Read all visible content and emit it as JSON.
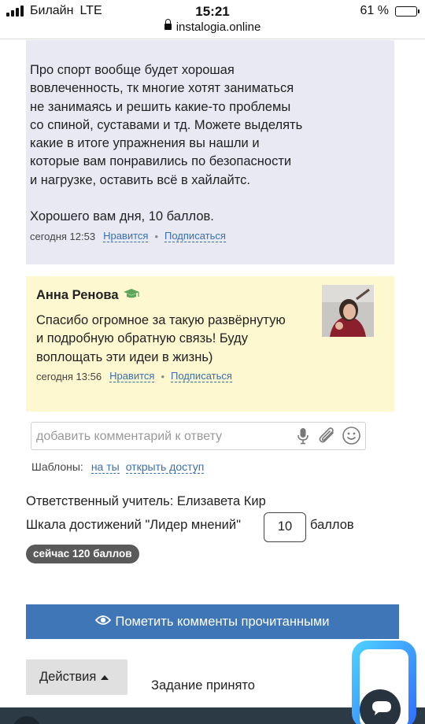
{
  "status_bar": {
    "carrier": "Билайн",
    "network": "LTE",
    "time": "15:21",
    "url": "instalogia.online",
    "battery_percent": "61 %",
    "battery_level": 0.61
  },
  "answer": {
    "text": "Про спорт вообще будет хорошая\nвовлеченность, тк многие хотят заниматься\nне занимаясь и решить какие-то проблемы\nсо спиной, суставами и тд. Можете выделять\nкакие в итоге упражнения вы нашли и\nкоторые вам понравились по безопасности\nи нагрузке, оставить всё в хайлайтс.\n\nХорошего вам дня, 10 баллов.",
    "time": "сегодня 12:53",
    "like": "Нравится",
    "subscribe": "Подписаться"
  },
  "comment": {
    "author": "Анна Ренова",
    "text": "Спасибо огромное за такую развёрнутую\nи подробную обратную связь! Буду\nвоплощать эти идеи в жизнь)",
    "time": "сегодня 13:56",
    "like": "Нравится",
    "subscribe": "Подписаться"
  },
  "comment_input": {
    "placeholder": "добавить комментарий к ответу"
  },
  "templates": {
    "label": "Шаблоны:",
    "items": [
      "на ты",
      "открыть доступ"
    ]
  },
  "teacher": "Ответственный учитель: Елизавета Кир",
  "scale": {
    "label": "Шкала достижений \"Лидер мнений\"",
    "value": "10",
    "unit": "баллов",
    "current": "сейчас 120 баллов"
  },
  "mark_read_button": "Пометить комменты прочитанными",
  "actions_button": "Действия",
  "status": "Задание принято",
  "colors": {
    "link": "#3a6fb0",
    "primary_button": "#3f76b8",
    "answer_bg": "#e8e9f2",
    "comment_bg": "#fdf8cf",
    "badge": "#5a5a5a",
    "chat_widget": "#3d8bff"
  },
  "icons": [
    "lock-icon",
    "graduation-cap-icon",
    "microphone-icon",
    "paperclip-icon",
    "smiley-icon",
    "eye-icon",
    "chat-icon"
  ]
}
